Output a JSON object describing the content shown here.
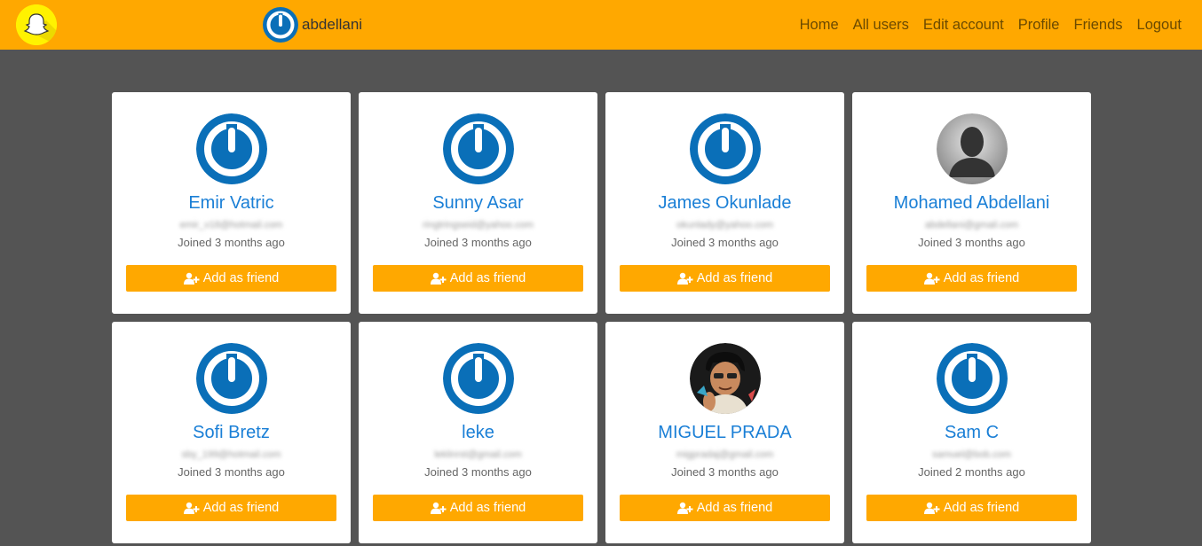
{
  "navbar": {
    "username": "abdellani",
    "links": [
      {
        "label": "Home"
      },
      {
        "label": "All users"
      },
      {
        "label": "Edit account"
      },
      {
        "label": "Profile"
      },
      {
        "label": "Friends"
      },
      {
        "label": "Logout"
      }
    ]
  },
  "colors": {
    "accent": "#ffa800",
    "background": "#545454",
    "link": "#1a7fd6",
    "avatar_blue": "#0a6fb8"
  },
  "users": [
    {
      "name": "Emir Vatric",
      "email": "emir_v18@hotmail.com",
      "joined": "Joined 3 months ago",
      "avatar": "power-avatar-icon",
      "add_label": "Add as friend"
    },
    {
      "name": "Sunny Asar",
      "email": "ringtringseid@yahoo.com",
      "joined": "Joined 3 months ago",
      "avatar": "power-avatar-icon",
      "add_label": "Add as friend"
    },
    {
      "name": "James Okunlade",
      "email": "okunlady@yahoo.com",
      "joined": "Joined 3 months ago",
      "avatar": "power-avatar-icon",
      "add_label": "Add as friend"
    },
    {
      "name": "Mohamed Abdellani",
      "email": "abdellani@gmail.com",
      "joined": "Joined 3 months ago",
      "avatar": "silhouette-avatar",
      "add_label": "Add as friend"
    },
    {
      "name": "Sofi Bretz",
      "email": "sby_199@hotmail.com",
      "joined": "Joined 3 months ago",
      "avatar": "power-avatar-icon",
      "add_label": "Add as friend"
    },
    {
      "name": "leke",
      "email": "leklinrst@gmail.com",
      "joined": "Joined 3 months ago",
      "avatar": "power-avatar-icon",
      "add_label": "Add as friend"
    },
    {
      "name": "MIGUEL PRADA",
      "email": "migpradaj@gmail.com",
      "joined": "Joined 3 months ago",
      "avatar": "photo-avatar",
      "add_label": "Add as friend"
    },
    {
      "name": "Sam C",
      "email": "samuel@bob.com",
      "joined": "Joined 2 months ago",
      "avatar": "power-avatar-icon",
      "add_label": "Add as friend"
    }
  ]
}
